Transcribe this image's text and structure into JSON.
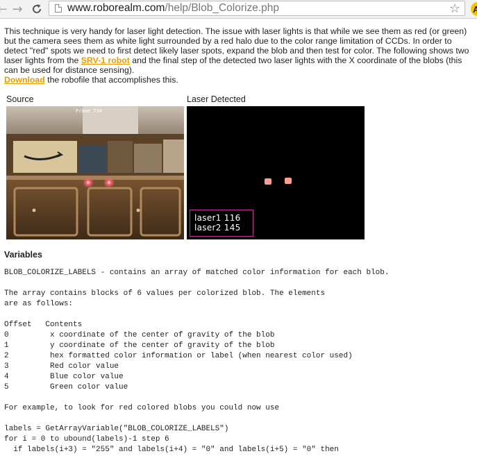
{
  "browser": {
    "url_host": "www.roborealm.com",
    "url_path": "/help/Blob_Colorize.php"
  },
  "intro": {
    "text_1": "This technique is very handy for laser light detection. The issue with laser lights is that while we see them as red (or green) but the camera sees them as white light surrounded by a red halo due to the color range limitation of CCDs. In order to detect \"red\" spots we need to first detect likely laser spots, expand the blob and then test for color. The following shows two laser lights from the ",
    "link_robot": "SRV-1 robot",
    "text_2": " and the final step of the detected two laser lights with the X coordinate of the blobs (this can be used for distance sensing).",
    "link_download": "Download",
    "text_3": " the robofile that accomplishes this."
  },
  "images": {
    "source_caption": "Source",
    "detected_caption": "Laser Detected",
    "source_overlay": "Frame   734",
    "laser_labels": [
      "laser1 116",
      "laser2 145"
    ],
    "laser_x": [
      116,
      145
    ]
  },
  "variables": {
    "title": "Variables",
    "line_1": "BLOB_COLORIZE_LABELS - contains an array of matched color information for each blob.",
    "line_2": "The array contains blocks of 6 values per colorized blob. The elements",
    "line_3": "are as follows:",
    "table_header": "Offset   Contents",
    "rows": [
      {
        "offset": "0",
        "content": "x coordinate of the center of gravity of the blob"
      },
      {
        "offset": "1",
        "content": "y coordinate of the center of gravity of the blob"
      },
      {
        "offset": "2",
        "content": "hex formatted color information or label (when nearest color used)"
      },
      {
        "offset": "3",
        "content": "Red color value"
      },
      {
        "offset": "4",
        "content": "Blue color value"
      },
      {
        "offset": "5",
        "content": "Green color value"
      }
    ],
    "example_intro": "For example, to look for red colored blobs you could now use",
    "code": [
      "labels = GetArrayVariable(\"BLOB_COLORIZE_LABELS\")",
      "for i = 0 to ubound(labels)-1 step 6",
      "  if labels(i+3) = \"255\" and labels(i+4) = \"0\" and labels(i+5) = \"0\" then"
    ]
  }
}
